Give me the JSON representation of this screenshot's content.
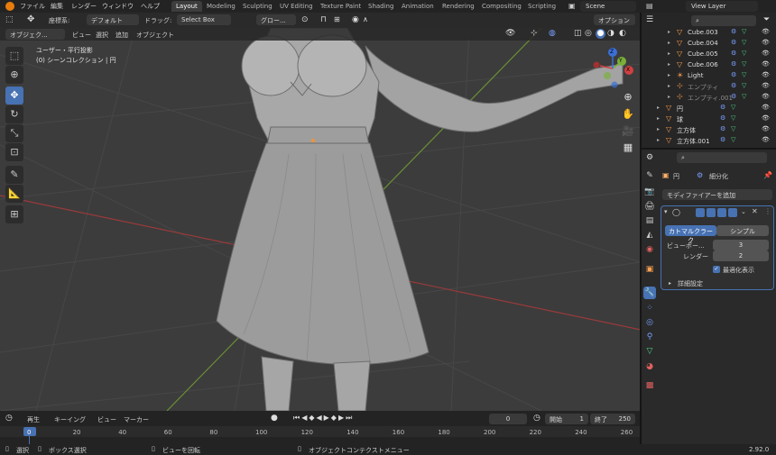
{
  "top_menu": {
    "file": "ファイル",
    "edit": "編集",
    "render": "レンダー",
    "window": "ウィンドウ",
    "help": "ヘルプ"
  },
  "workspace_tabs": [
    "Layout",
    "Modeling",
    "Sculpting",
    "UV Editing",
    "Texture Paint",
    "Shading",
    "Animation",
    "Rendering",
    "Compositing",
    "Scripting"
  ],
  "scene": "Scene",
  "view_layer": "View Layer",
  "header": {
    "coord_label": "座標系:",
    "coord_value": "デフォルト",
    "drag_label": "ドラッグ:",
    "drag_value": "Select Box",
    "global": "グロー...",
    "options": "オプション"
  },
  "viewport_menu": {
    "mode": "オブジェク...",
    "view": "ビュー",
    "select": "選択",
    "add": "追加",
    "object": "オブジェクト"
  },
  "viewport_info": {
    "line1": "ユーザー・平行投影",
    "line2": "(0) シーンコレクション | 円"
  },
  "gizmo": {
    "x": "X",
    "y": "Y",
    "z": "Z"
  },
  "outliner": {
    "items": [
      {
        "name": "Cube.003",
        "kind": "mesh",
        "level": 2
      },
      {
        "name": "Cube.004",
        "kind": "mesh",
        "level": 2
      },
      {
        "name": "Cube.005",
        "kind": "mesh",
        "level": 2
      },
      {
        "name": "Cube.006",
        "kind": "mesh",
        "level": 2
      },
      {
        "name": "Light",
        "kind": "light",
        "level": 2
      },
      {
        "name": "エンプティ",
        "kind": "empty",
        "level": 2
      },
      {
        "name": "エンプティ.001",
        "kind": "empty",
        "level": 2
      },
      {
        "name": "円",
        "kind": "mesh",
        "level": 1
      },
      {
        "name": "球",
        "kind": "mesh",
        "level": 1
      },
      {
        "name": "立方体",
        "kind": "mesh",
        "level": 1
      },
      {
        "name": "立方体.001",
        "kind": "mesh",
        "level": 1
      }
    ]
  },
  "properties": {
    "object_name": "円",
    "modifier_name": "細分化",
    "add_modifier": "モディファイアーを追加",
    "catmull": "カトマルクラーク",
    "simple": "シンプル",
    "viewport_label": "ビューポー...",
    "viewport_value": "3",
    "render_label": "レンダー",
    "render_value": "2",
    "optimal": "最適化表示",
    "advanced": "詳細設定"
  },
  "timeline": {
    "playback": "再生",
    "keying": "キーイング",
    "view": "ビュー",
    "marker": "マーカー",
    "current_frame": "0",
    "start_label": "開始",
    "start": "1",
    "end_label": "終了",
    "end": "250",
    "ruler": [
      "0",
      "20",
      "40",
      "60",
      "80",
      "100",
      "120",
      "140",
      "160",
      "180",
      "200",
      "220",
      "240",
      "260"
    ]
  },
  "status": {
    "select": "選択",
    "box_select": "ボックス選択",
    "rotate": "ビューを回転",
    "context": "オブジェクトコンテクストメニュー",
    "version": "2.92.0"
  },
  "colors": {
    "accent": "#4772b3",
    "viewport": "#3c3c3c",
    "x_axis": "#d04040",
    "y_axis": "#7ab03a",
    "z_axis": "#3b6fd6",
    "origin": "#f09530"
  }
}
